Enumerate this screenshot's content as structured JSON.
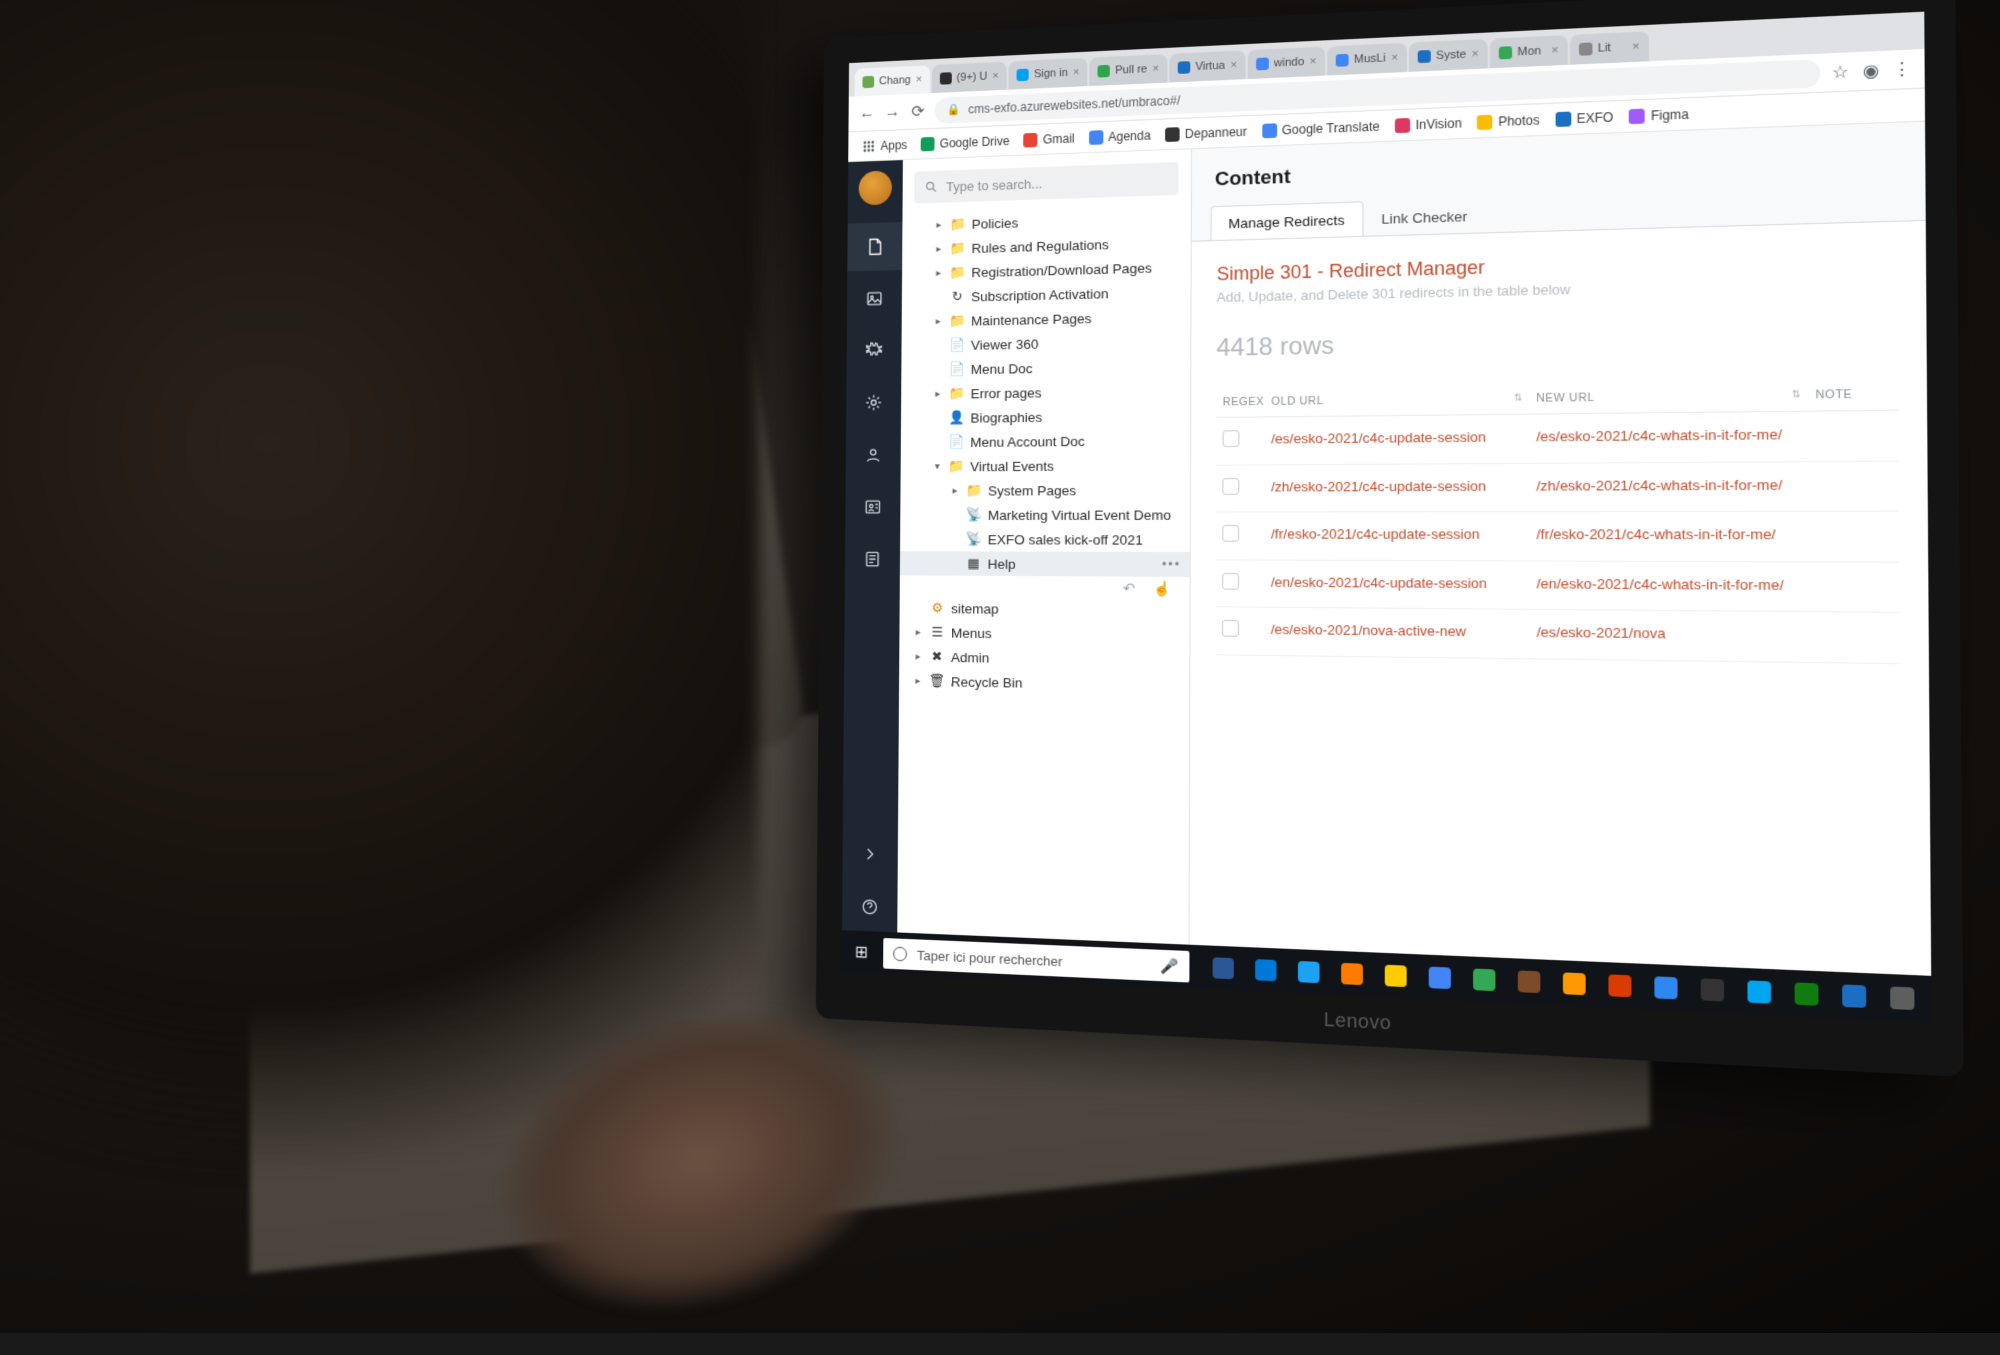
{
  "laptop_brand": "Lenovo",
  "browser": {
    "tabs": [
      {
        "label": "Chang",
        "fav": "#6aa84f"
      },
      {
        "label": "(9+) U",
        "fav": "#2b2b2b"
      },
      {
        "label": "Sign in",
        "fav": "#00a1f1"
      },
      {
        "label": "Pull re",
        "fav": "#2ea44f"
      },
      {
        "label": "Virtua",
        "fav": "#1b6ec2"
      },
      {
        "label": "windo",
        "fav": "#4285f4"
      },
      {
        "label": "MusLi",
        "fav": "#4285f4"
      },
      {
        "label": "Syste",
        "fav": "#1b6ec2"
      },
      {
        "label": "Mon",
        "fav": "#34a853"
      },
      {
        "label": "Lit",
        "fav": "#888888"
      }
    ],
    "url": "cms-exfo.azurewebsites.net/umbraco#/",
    "bookmarks": [
      {
        "label": "Apps",
        "color": "#5f6368"
      },
      {
        "label": "Google Drive",
        "color": "#0f9d58"
      },
      {
        "label": "Gmail",
        "color": "#ea4335"
      },
      {
        "label": "Agenda",
        "color": "#4285f4"
      },
      {
        "label": "Depanneur",
        "color": "#333333"
      },
      {
        "label": "Google Translate",
        "color": "#4285f4"
      },
      {
        "label": "InVision",
        "color": "#dc395f"
      },
      {
        "label": "Photos",
        "color": "#fbbc04"
      },
      {
        "label": "EXFO",
        "color": "#1b6ec2"
      },
      {
        "label": "Figma",
        "color": "#a259ff"
      }
    ]
  },
  "search_placeholder": "Type to search...",
  "tree": [
    {
      "depth": 1,
      "arrow": "▸",
      "icon": "folder",
      "label": "Policies"
    },
    {
      "depth": 1,
      "arrow": "▸",
      "icon": "folder",
      "label": "Rules and Regulations"
    },
    {
      "depth": 1,
      "arrow": "▸",
      "icon": "folder",
      "label": "Registration/Download Pages"
    },
    {
      "depth": 1,
      "arrow": "",
      "icon": "refresh",
      "label": "Subscription Activation"
    },
    {
      "depth": 1,
      "arrow": "▸",
      "icon": "folder",
      "label": "Maintenance Pages"
    },
    {
      "depth": 1,
      "arrow": "",
      "icon": "doc",
      "label": "Viewer 360"
    },
    {
      "depth": 1,
      "arrow": "",
      "icon": "doc",
      "label": "Menu Doc"
    },
    {
      "depth": 1,
      "arrow": "▸",
      "icon": "folder",
      "label": "Error pages"
    },
    {
      "depth": 1,
      "arrow": "",
      "icon": "bio",
      "label": "Biographies"
    },
    {
      "depth": 1,
      "arrow": "",
      "icon": "doc",
      "label": "Menu Account Doc"
    },
    {
      "depth": 1,
      "arrow": "▾",
      "icon": "folder",
      "label": "Virtual Events"
    },
    {
      "depth": 2,
      "arrow": "▸",
      "icon": "folder",
      "label": "System Pages"
    },
    {
      "depth": 2,
      "arrow": "",
      "icon": "antenna",
      "label": "Marketing Virtual Event Demo"
    },
    {
      "depth": 2,
      "arrow": "",
      "icon": "antenna",
      "label": "EXFO sales kick-off 2021"
    },
    {
      "depth": 2,
      "arrow": "",
      "icon": "grid",
      "label": "Help",
      "selected": true,
      "dots": true
    },
    {
      "depth": 0,
      "arrow": "",
      "icon": "sitemap",
      "label": "sitemap",
      "orange": true
    },
    {
      "depth": 0,
      "arrow": "▸",
      "icon": "menus",
      "label": "Menus"
    },
    {
      "depth": 0,
      "arrow": "▸",
      "icon": "admin",
      "label": "Admin"
    },
    {
      "depth": 0,
      "arrow": "▸",
      "icon": "trash",
      "label": "Recycle Bin"
    }
  ],
  "content": {
    "heading": "Content",
    "tabs": {
      "active": "Manage Redirects",
      "other": "Link Checker"
    },
    "panel_title": "Simple 301 - Redirect Manager",
    "panel_sub": "Add, Update, and Delete 301 redirects in the table below",
    "row_count": "4418 rows",
    "columns": {
      "regex": "REGEX",
      "old": "OLD URL",
      "new": "NEW URL",
      "note": "NOTE"
    },
    "rows": [
      {
        "old": "/es/esko-2021/c4c-update-session",
        "new": "/es/esko-2021/c4c-whats-in-it-for-me/"
      },
      {
        "old": "/zh/esko-2021/c4c-update-session",
        "new": "/zh/esko-2021/c4c-whats-in-it-for-me/"
      },
      {
        "old": "/fr/esko-2021/c4c-update-session",
        "new": "/fr/esko-2021/c4c-whats-in-it-for-me/"
      },
      {
        "old": "/en/esko-2021/c4c-update-session",
        "new": "/en/esko-2021/c4c-whats-in-it-for-me/"
      },
      {
        "old": "/es/esko-2021/nova-active-new",
        "new": "/es/esko-2021/nova"
      }
    ]
  },
  "taskbar": {
    "search_placeholder": "Taper ici pour rechercher",
    "icons": [
      "#2b5797",
      "#0078d7",
      "#1da1f2",
      "#ff7b00",
      "#ffcc00",
      "#4285f4",
      "#34a853",
      "#7b4b2a",
      "#ff9900",
      "#da3b01",
      "#2d89ef",
      "#333333",
      "#00a4ef",
      "#107c10",
      "#1b6ec2",
      "#5e5e5e"
    ]
  }
}
